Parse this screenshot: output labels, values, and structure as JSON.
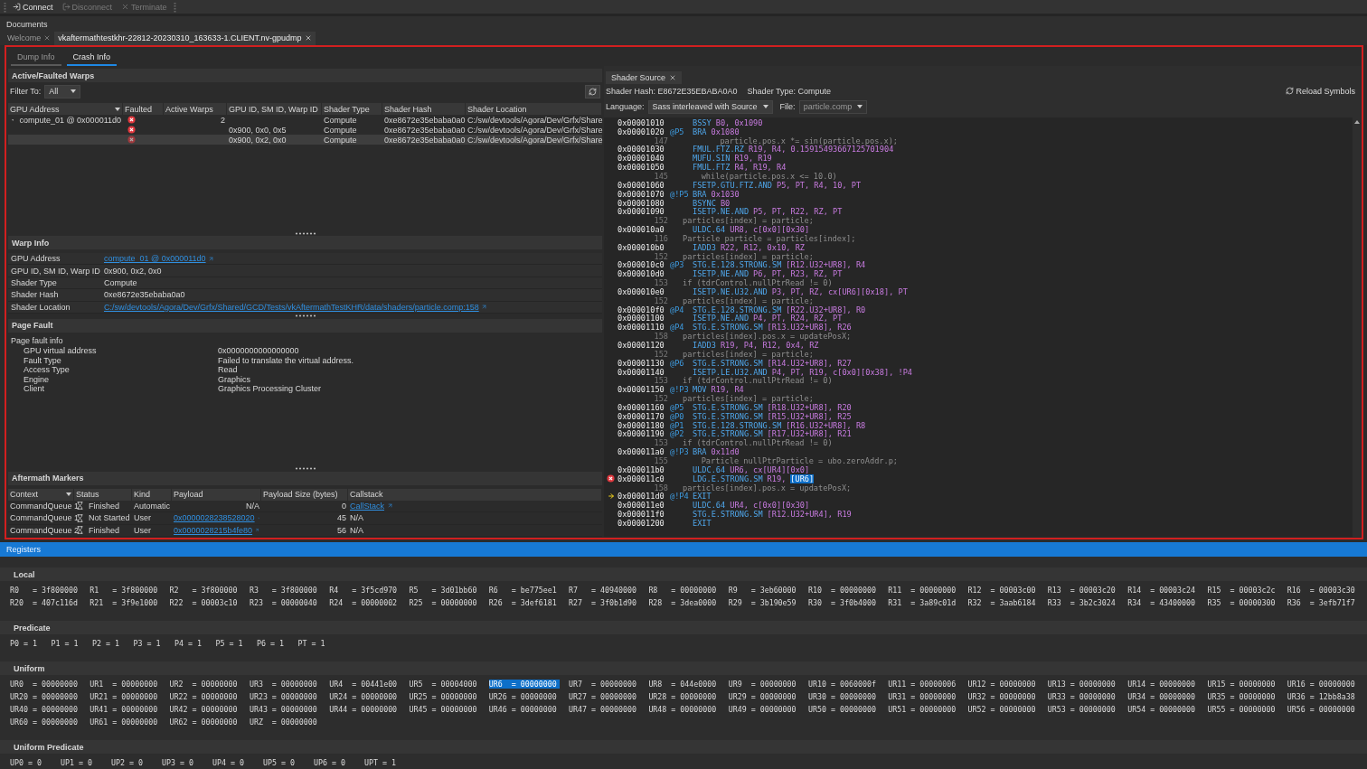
{
  "toolbar": [
    {
      "label": "Connect",
      "disabled": false
    },
    {
      "label": "Disconnect",
      "disabled": true
    },
    {
      "label": "Terminate",
      "disabled": true
    }
  ],
  "documents": {
    "title": "Documents",
    "tabs": [
      {
        "label": "Welcome",
        "selected": false
      },
      {
        "label": "vkaftermathtestkhr-22812-20230310_163633-1.CLIENT.nv-gpudmp",
        "selected": true
      }
    ]
  },
  "view_tabs": [
    {
      "label": "Dump Info",
      "selected": false
    },
    {
      "label": "Crash Info",
      "selected": true
    }
  ],
  "warps": {
    "title": "Active/Faulted Warps",
    "filter": {
      "label": "Filter To:",
      "value": "All"
    },
    "columns": [
      "GPU Address",
      "Faulted",
      "Active Warps",
      "GPU ID, SM ID, Warp ID",
      "Shader Type",
      "Shader Hash",
      "Shader Location"
    ],
    "rows": [
      {
        "gpu_address": "compute_01 @ 0x000011d0",
        "faulted": true,
        "active_warps": "2",
        "shader_type": "Compute",
        "shader_hash": "0xe8672e35ebaba0a0",
        "shader_location": "C:/sw/devtools/Agora/Dev/Grfx/Share",
        "selected": false,
        "expanded": true,
        "children": [
          {
            "faulted": true,
            "ids": "0x900, 0x0, 0x5",
            "shader_type": "Compute",
            "shader_hash": "0xe8672e35ebaba0a0",
            "shader_location": "C:/sw/devtools/Agora/Dev/Grfx/Share",
            "selected": false
          },
          {
            "faulted": true,
            "ids": "0x900, 0x2, 0x0",
            "shader_type": "Compute",
            "shader_hash": "0xe8672e35ebaba0a0",
            "shader_location": "C:/sw/devtools/Agora/Dev/Grfx/Share",
            "selected": true
          }
        ]
      }
    ]
  },
  "warp_info": {
    "title": "Warp Info",
    "fields": [
      {
        "label": "GPU Address",
        "value": "compute_01 @ 0x000011d0",
        "link": true
      },
      {
        "label": "GPU ID, SM ID, Warp ID",
        "value": "0x900, 0x2, 0x0",
        "link": false
      },
      {
        "label": "Shader Type",
        "value": "Compute",
        "link": false
      },
      {
        "label": "Shader Hash",
        "value": "0xe8672e35ebaba0a0",
        "link": false
      },
      {
        "label": "Shader Location",
        "value": "C:/sw/devtools/Agora/Dev/Grfx/Shared/GCD/Tests/vkAftermathTestKHR/data/shaders/particle.comp:158",
        "link": true
      }
    ]
  },
  "page_fault": {
    "title": "Page Fault",
    "heading": "Page fault info",
    "fields": [
      {
        "label": "GPU virtual address",
        "value": "0x0000000000000000"
      },
      {
        "label": "Fault Type",
        "value": "Failed to translate the virtual address."
      },
      {
        "label": "Access Type",
        "value": "Read"
      },
      {
        "label": "Engine",
        "value": "Graphics"
      },
      {
        "label": "Client",
        "value": "Graphics Processing Cluster"
      }
    ]
  },
  "markers": {
    "title": "Aftermath Markers",
    "columns": [
      "Context",
      "Status",
      "Kind",
      "Payload",
      "Payload Size (bytes)",
      "Callstack"
    ],
    "rows": [
      {
        "context": "CommandQueue 1",
        "status": "Finished",
        "kind": "Automatic",
        "payload": {
          "text": "N/A",
          "link": false
        },
        "payload_size": "0",
        "callstack": {
          "text": "CallStack",
          "link": true
        }
      },
      {
        "context": "CommandQueue 1",
        "status": "Not Started",
        "kind": "User",
        "payload": {
          "text": "0x0000028238528020",
          "link": true
        },
        "payload_size": "45",
        "callstack": {
          "text": "N/A",
          "link": false
        }
      },
      {
        "context": "CommandQueue 2",
        "status": "Finished",
        "kind": "User",
        "payload": {
          "text": "0x0000028215b4fe80",
          "link": true
        },
        "payload_size": "56",
        "callstack": {
          "text": "N/A",
          "link": false
        }
      }
    ]
  },
  "shader": {
    "tab": "Shader Source",
    "hash": "Shader Hash: E8672E35EBABA0A0",
    "type": "Shader Type: Compute",
    "reload": "Reload Symbols",
    "language": {
      "label": "Language:",
      "value": "Sass interleaved with Source"
    },
    "file": {
      "label": "File:",
      "value": "particle.comp",
      "disabled": true
    },
    "lines": [
      {
        "kind": "asm",
        "address": "0x00001010",
        "opcode": "BSSY",
        "operands": "B0, 0x1090"
      },
      {
        "kind": "asm",
        "address": "0x00001020",
        "predicate": "@P5",
        "opcode": "BRA",
        "operands": "0x1080"
      },
      {
        "kind": "src",
        "line": "147",
        "text": "        particle.pos.x *= sin(particle.pos.x);"
      },
      {
        "kind": "asm",
        "address": "0x00001030",
        "opcode": "FMUL.FTZ.RZ",
        "operands": "R19, R4, 0.15915493667125701904"
      },
      {
        "kind": "asm",
        "address": "0x00001040",
        "opcode": "MUFU.SIN",
        "operands": "R19, R19"
      },
      {
        "kind": "asm",
        "address": "0x00001050",
        "opcode": "FMUL.FTZ",
        "operands": "R4, R19, R4"
      },
      {
        "kind": "src",
        "line": "145",
        "text": "    while(particle.pos.x <= 10.0)"
      },
      {
        "kind": "asm",
        "address": "0x00001060",
        "opcode": "FSETP.GTU.FTZ.AND",
        "operands": "P5, PT, R4, 10, PT"
      },
      {
        "kind": "asm",
        "address": "0x00001070",
        "predicate": "@!P5",
        "opcode": "BRA",
        "operands": "0x1030"
      },
      {
        "kind": "asm",
        "address": "0x00001080",
        "opcode": "BSYNC",
        "operands": "B0"
      },
      {
        "kind": "asm",
        "address": "0x00001090",
        "opcode": "ISETP.NE.AND",
        "operands": "P5, PT, R22, RZ, PT"
      },
      {
        "kind": "src",
        "line": "152",
        "text": "particles[index] = particle;"
      },
      {
        "kind": "asm",
        "address": "0x000010a0",
        "opcode": "ULDC.64",
        "operands": "UR8, c[0x0][0x30]"
      },
      {
        "kind": "src",
        "line": "116",
        "text": "Particle particle = particles[index];"
      },
      {
        "kind": "asm",
        "address": "0x000010b0",
        "opcode": "IADD3",
        "operands": "R22, R12, 0x10, RZ"
      },
      {
        "kind": "src",
        "line": "152",
        "text": "particles[index] = particle;"
      },
      {
        "kind": "asm",
        "address": "0x000010c0",
        "predicate": "@P3",
        "opcode": "STG.E.128.STRONG.SM",
        "operands": "[R12.U32+UR8], R4"
      },
      {
        "kind": "asm",
        "address": "0x000010d0",
        "opcode": "ISETP.NE.AND",
        "operands": "P6, PT, R23, RZ, PT"
      },
      {
        "kind": "src",
        "line": "153",
        "text": "if (tdrControl.nullPtrRead != 0)"
      },
      {
        "kind": "asm",
        "address": "0x000010e0",
        "opcode": "ISETP.NE.U32.AND",
        "operands": "P3, PT, RZ, cx[UR6][0x18], PT"
      },
      {
        "kind": "src",
        "line": "152",
        "text": "particles[index] = particle;"
      },
      {
        "kind": "asm",
        "address": "0x000010f0",
        "predicate": "@P4",
        "opcode": "STG.E.128.STRONG.SM",
        "operands": "[R22.U32+UR8], R0"
      },
      {
        "kind": "asm",
        "address": "0x00001100",
        "opcode": "ISETP.NE.AND",
        "operands": "P4, PT, R24, RZ, PT"
      },
      {
        "kind": "asm",
        "address": "0x00001110",
        "predicate": "@P4",
        "opcode": "STG.E.STRONG.SM",
        "operands": "[R13.U32+UR8], R26"
      },
      {
        "kind": "src",
        "line": "158",
        "text": "particles[index].pos.x = updatePosX;"
      },
      {
        "kind": "asm",
        "address": "0x00001120",
        "opcode": "IADD3",
        "operands": "R19, P4, R12, 0x4, RZ"
      },
      {
        "kind": "src",
        "line": "152",
        "text": "particles[index] = particle;"
      },
      {
        "kind": "asm",
        "address": "0x00001130",
        "predicate": "@P6",
        "opcode": "STG.E.STRONG.SM",
        "operands": "[R14.U32+UR8], R27"
      },
      {
        "kind": "asm",
        "address": "0x00001140",
        "opcode": "ISETP.LE.U32.AND",
        "operands": "P4, PT, R19, c[0x0][0x38], !P4"
      },
      {
        "kind": "src",
        "line": "153",
        "text": "if (tdrControl.nullPtrRead != 0)"
      },
      {
        "kind": "asm",
        "address": "0x00001150",
        "predicate": "@!P3",
        "opcode": "MOV",
        "operands": "R19, R4"
      },
      {
        "kind": "src",
        "line": "152",
        "text": "particles[index] = particle;"
      },
      {
        "kind": "asm",
        "address": "0x00001160",
        "predicate": "@P5",
        "opcode": "STG.E.STRONG.SM",
        "operands": "[R18.U32+UR8], R20"
      },
      {
        "kind": "asm",
        "address": "0x00001170",
        "predicate": "@P0",
        "opcode": "STG.E.STRONG.SM",
        "operands": "[R15.U32+UR8], R25"
      },
      {
        "kind": "asm",
        "address": "0x00001180",
        "predicate": "@P1",
        "opcode": "STG.E.128.STRONG.SM",
        "operands": "[R16.U32+UR8], R8"
      },
      {
        "kind": "asm",
        "address": "0x00001190",
        "predicate": "@P2",
        "opcode": "STG.E.STRONG.SM",
        "operands": "[R17.U32+UR8], R21"
      },
      {
        "kind": "src",
        "line": "153",
        "text": "if (tdrControl.nullPtrRead != 0)"
      },
      {
        "kind": "asm",
        "address": "0x000011a0",
        "predicate": "@!P3",
        "opcode": "BRA",
        "operands": "0x11d0"
      },
      {
        "kind": "src",
        "line": "155",
        "text": "    Particle nullPtrParticle = ubo.zeroAddr.p;"
      },
      {
        "kind": "asm",
        "address": "0x000011b0",
        "opcode": "ULDC.64",
        "operands": "UR6, cx[UR4][0x0]"
      },
      {
        "kind": "asm",
        "address": "0x000011c0",
        "faulted": true,
        "opcode": "LDG.E.STRONG.SM",
        "operands": "R19,",
        "selected_operand": "[UR6]"
      },
      {
        "kind": "src",
        "line": "158",
        "text": "particles[index].pos.x = updatePosX;"
      },
      {
        "kind": "asm",
        "address": "0x000011d0",
        "current": true,
        "predicate": "@!P4",
        "opcode": "EXIT"
      },
      {
        "kind": "asm",
        "address": "0x000011e0",
        "opcode": "ULDC.64",
        "operands": "UR4, c[0x0][0x30]"
      },
      {
        "kind": "asm",
        "address": "0x000011f0",
        "opcode": "STG.E.STRONG.SM",
        "operands": "[R12.U32+UR4], R19"
      },
      {
        "kind": "asm",
        "address": "0x00001200",
        "opcode": "EXIT"
      }
    ]
  },
  "registers": {
    "title": "Registers",
    "separator": "=",
    "groups": [
      {
        "title": "Local",
        "kind": "wide",
        "rows": [
          [
            {
              "name": "R0",
              "value": "3f800000"
            },
            {
              "name": "R1",
              "value": "3f800000"
            },
            {
              "name": "R2",
              "value": "3f800000"
            },
            {
              "name": "R3",
              "value": "3f800000"
            },
            {
              "name": "R4",
              "value": "3f5cd970"
            },
            {
              "name": "R5",
              "value": "3d01bb60"
            },
            {
              "name": "R6",
              "value": "be775ee1"
            },
            {
              "name": "R7",
              "value": "40940000"
            },
            {
              "name": "R8",
              "value": "00000000"
            },
            {
              "name": "R9",
              "value": "3eb60000"
            },
            {
              "name": "R10",
              "value": "00000000"
            },
            {
              "name": "R11",
              "value": "00000000"
            },
            {
              "name": "R12",
              "value": "00003c00"
            },
            {
              "name": "R13",
              "value": "00003c20"
            },
            {
              "name": "R14",
              "value": "00003c24"
            },
            {
              "name": "R15",
              "value": "00003c2c"
            },
            {
              "name": "R16",
              "value": "00003c30"
            }
          ],
          [
            {
              "name": "R20",
              "value": "407c116d"
            },
            {
              "name": "R21",
              "value": "3f9e1000"
            },
            {
              "name": "R22",
              "value": "00003c10"
            },
            {
              "name": "R23",
              "value": "00000040"
            },
            {
              "name": "R24",
              "value": "00000002"
            },
            {
              "name": "R25",
              "value": "00000000"
            },
            {
              "name": "R26",
              "value": "3def6181"
            },
            {
              "name": "R27",
              "value": "3f0b1d90"
            },
            {
              "name": "R28",
              "value": "3dea0000"
            },
            {
              "name": "R29",
              "value": "3b190e59"
            },
            {
              "name": "R30",
              "value": "3f0b4000"
            },
            {
              "name": "R31",
              "value": "3a89c01d"
            },
            {
              "name": "R32",
              "value": "3aab6184"
            },
            {
              "name": "R33",
              "value": "3b2c3024"
            },
            {
              "name": "R34",
              "value": "43400000"
            },
            {
              "name": "R35",
              "value": "00000300"
            },
            {
              "name": "R36",
              "value": "3efb71f7"
            }
          ]
        ]
      },
      {
        "title": "Predicate",
        "kind": "narrow",
        "rows": [
          [
            {
              "name": "P0",
              "value": "1"
            },
            {
              "name": "P1",
              "value": "1"
            },
            {
              "name": "P2",
              "value": "1"
            },
            {
              "name": "P3",
              "value": "1"
            },
            {
              "name": "P4",
              "value": "1"
            },
            {
              "name": "P5",
              "value": "1"
            },
            {
              "name": "P6",
              "value": "1"
            },
            {
              "name": "PT",
              "value": "1"
            }
          ]
        ]
      },
      {
        "title": "Uniform",
        "kind": "wide",
        "rows": [
          [
            {
              "name": "UR0",
              "value": "00000000",
              "selected": false
            },
            {
              "name": "UR1",
              "value": "00000000",
              "selected": false
            },
            {
              "name": "UR2",
              "value": "00000000",
              "selected": false
            },
            {
              "name": "UR3",
              "value": "00000000",
              "selected": false
            },
            {
              "name": "UR4",
              "value": "00441e00",
              "selected": false
            },
            {
              "name": "UR5",
              "value": "00004000",
              "selected": false
            },
            {
              "name": "UR6",
              "value": "00000000",
              "selected": true
            },
            {
              "name": "UR7",
              "value": "00000000",
              "selected": false
            },
            {
              "name": "UR8",
              "value": "044e0000",
              "selected": false
            },
            {
              "name": "UR9",
              "value": "00000000",
              "selected": false
            },
            {
              "name": "UR10",
              "value": "0060000f",
              "selected": false
            },
            {
              "name": "UR11",
              "value": "00000006",
              "selected": false
            },
            {
              "name": "UR12",
              "value": "00000000",
              "selected": false
            },
            {
              "name": "UR13",
              "value": "00000000",
              "selected": false
            },
            {
              "name": "UR14",
              "value": "00000000",
              "selected": false
            },
            {
              "name": "UR15",
              "value": "00000000",
              "selected": false
            },
            {
              "name": "UR16",
              "value": "00000000",
              "selected": false
            }
          ],
          [
            {
              "name": "UR20",
              "value": "00000000",
              "selected": false
            },
            {
              "name": "UR21",
              "value": "00000000",
              "selected": false
            },
            {
              "name": "UR22",
              "value": "00000000",
              "selected": false
            },
            {
              "name": "UR23",
              "value": "00000000",
              "selected": false
            },
            {
              "name": "UR24",
              "value": "00000000",
              "selected": false
            },
            {
              "name": "UR25",
              "value": "00000000",
              "selected": false
            },
            {
              "name": "UR26",
              "value": "00000000",
              "selected": false
            },
            {
              "name": "UR27",
              "value": "00000000",
              "selected": false
            },
            {
              "name": "UR28",
              "value": "00000000",
              "selected": false
            },
            {
              "name": "UR29",
              "value": "00000000",
              "selected": false
            },
            {
              "name": "UR30",
              "value": "00000000",
              "selected": false
            },
            {
              "name": "UR31",
              "value": "00000000",
              "selected": false
            },
            {
              "name": "UR32",
              "value": "00000000",
              "selected": false
            },
            {
              "name": "UR33",
              "value": "00000000",
              "selected": false
            },
            {
              "name": "UR34",
              "value": "00000000",
              "selected": false
            },
            {
              "name": "UR35",
              "value": "00000000",
              "selected": false
            },
            {
              "name": "UR36",
              "value": "12bb8a38",
              "selected": false
            }
          ],
          [
            {
              "name": "UR40",
              "value": "00000000",
              "selected": false
            },
            {
              "name": "UR41",
              "value": "00000000",
              "selected": false
            },
            {
              "name": "UR42",
              "value": "00000000",
              "selected": false
            },
            {
              "name": "UR43",
              "value": "00000000",
              "selected": false
            },
            {
              "name": "UR44",
              "value": "00000000",
              "selected": false
            },
            {
              "name": "UR45",
              "value": "00000000",
              "selected": false
            },
            {
              "name": "UR46",
              "value": "00000000",
              "selected": false
            },
            {
              "name": "UR47",
              "value": "00000000",
              "selected": false
            },
            {
              "name": "UR48",
              "value": "00000000",
              "selected": false
            },
            {
              "name": "UR49",
              "value": "00000000",
              "selected": false
            },
            {
              "name": "UR50",
              "value": "00000000",
              "selected": false
            },
            {
              "name": "UR51",
              "value": "00000000",
              "selected": false
            },
            {
              "name": "UR52",
              "value": "00000000",
              "selected": false
            },
            {
              "name": "UR53",
              "value": "00000000",
              "selected": false
            },
            {
              "name": "UR54",
              "value": "00000000",
              "selected": false
            },
            {
              "name": "UR55",
              "value": "00000000",
              "selected": false
            },
            {
              "name": "UR56",
              "value": "00000000",
              "selected": false
            }
          ],
          [
            {
              "name": "UR60",
              "value": "00000000",
              "selected": false
            },
            {
              "name": "UR61",
              "value": "00000000",
              "selected": false
            },
            {
              "name": "UR62",
              "value": "00000000",
              "selected": false
            },
            {
              "name": "URZ",
              "value": "00000000",
              "selected": false
            }
          ]
        ]
      },
      {
        "title": "Uniform Predicate",
        "kind": "medium",
        "rows": [
          [
            {
              "name": "UP0",
              "value": "0"
            },
            {
              "name": "UP1",
              "value": "0"
            },
            {
              "name": "UP2",
              "value": "0"
            },
            {
              "name": "UP3",
              "value": "0"
            },
            {
              "name": "UP4",
              "value": "0"
            },
            {
              "name": "UP5",
              "value": "0"
            },
            {
              "name": "UP6",
              "value": "0"
            },
            {
              "name": "UPT",
              "value": "1"
            }
          ]
        ]
      }
    ]
  }
}
